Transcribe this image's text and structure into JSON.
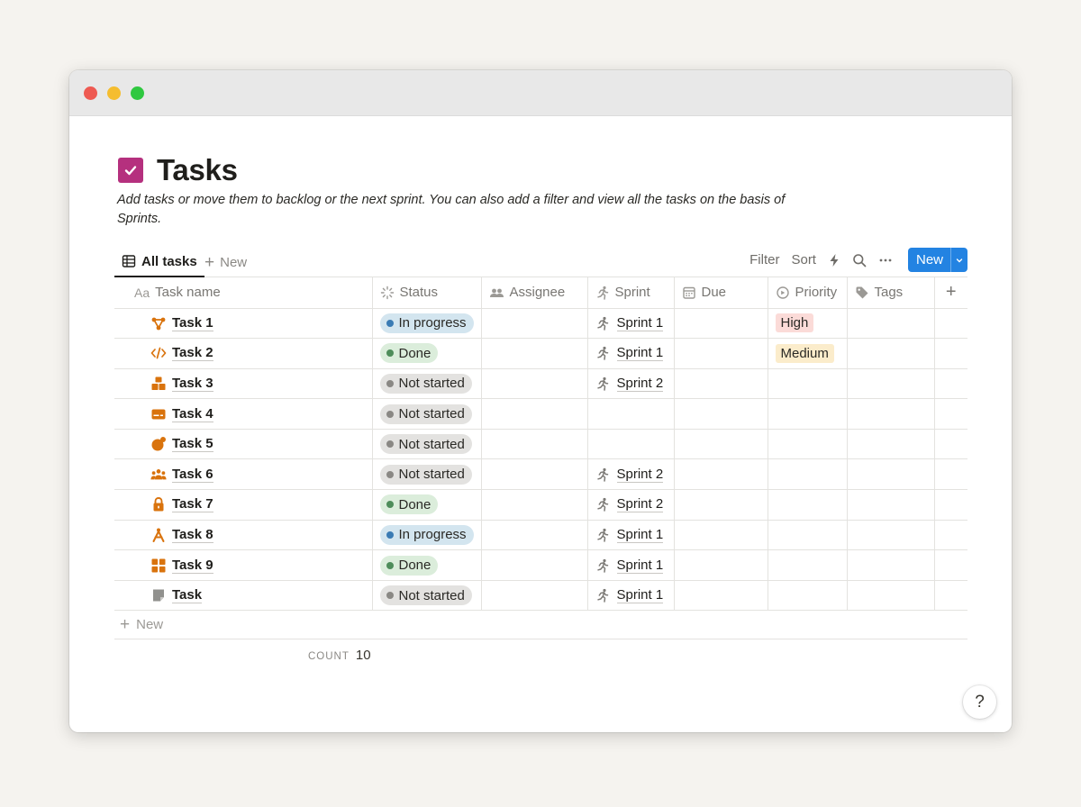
{
  "page": {
    "title": "Tasks",
    "description": "Add tasks or move them to backlog or the next sprint. You can also add a filter and view all the tasks on the basis of Sprints."
  },
  "view": {
    "active_tab": "All tasks",
    "new_tab_label": "New",
    "tools": {
      "filter": "Filter",
      "sort": "Sort"
    },
    "new_button": "New"
  },
  "columns": {
    "name_prefix": "Aa",
    "name": "Task name",
    "status": "Status",
    "assignee": "Assignee",
    "sprint": "Sprint",
    "due": "Due",
    "priority": "Priority",
    "tags": "Tags"
  },
  "rows": [
    {
      "icon": "diamond-network-icon",
      "name": "Task 1",
      "status": "In progress",
      "sprint": "Sprint 1",
      "priority": "High"
    },
    {
      "icon": "code-icon",
      "name": "Task 2",
      "status": "Done",
      "sprint": "Sprint 1",
      "priority": "Medium"
    },
    {
      "icon": "boxes-icon",
      "name": "Task 3",
      "status": "Not started",
      "sprint": "Sprint 2",
      "priority": ""
    },
    {
      "icon": "card-icon",
      "name": "Task 4",
      "status": "Not started",
      "sprint": "",
      "priority": ""
    },
    {
      "icon": "blob-icon",
      "name": "Task 5",
      "status": "Not started",
      "sprint": "",
      "priority": ""
    },
    {
      "icon": "people-icon",
      "name": "Task 6",
      "status": "Not started",
      "sprint": "Sprint 2",
      "priority": ""
    },
    {
      "icon": "lock-icon",
      "name": "Task 7",
      "status": "Done",
      "sprint": "Sprint 2",
      "priority": ""
    },
    {
      "icon": "compass-icon",
      "name": "Task 8",
      "status": "In progress",
      "sprint": "Sprint 1",
      "priority": ""
    },
    {
      "icon": "grid-icon",
      "name": "Task 9",
      "status": "Done",
      "sprint": "Sprint 1",
      "priority": ""
    },
    {
      "icon": "page-icon",
      "name": "Task",
      "status": "Not started",
      "sprint": "Sprint 1",
      "priority": ""
    }
  ],
  "footer": {
    "new_row_label": "New",
    "count_label": "COUNT",
    "count_value": "10"
  },
  "help": "?",
  "colors": {
    "accent": "#2383e2",
    "page_icon": "#b5307e",
    "task_icon": "#d9730d"
  }
}
